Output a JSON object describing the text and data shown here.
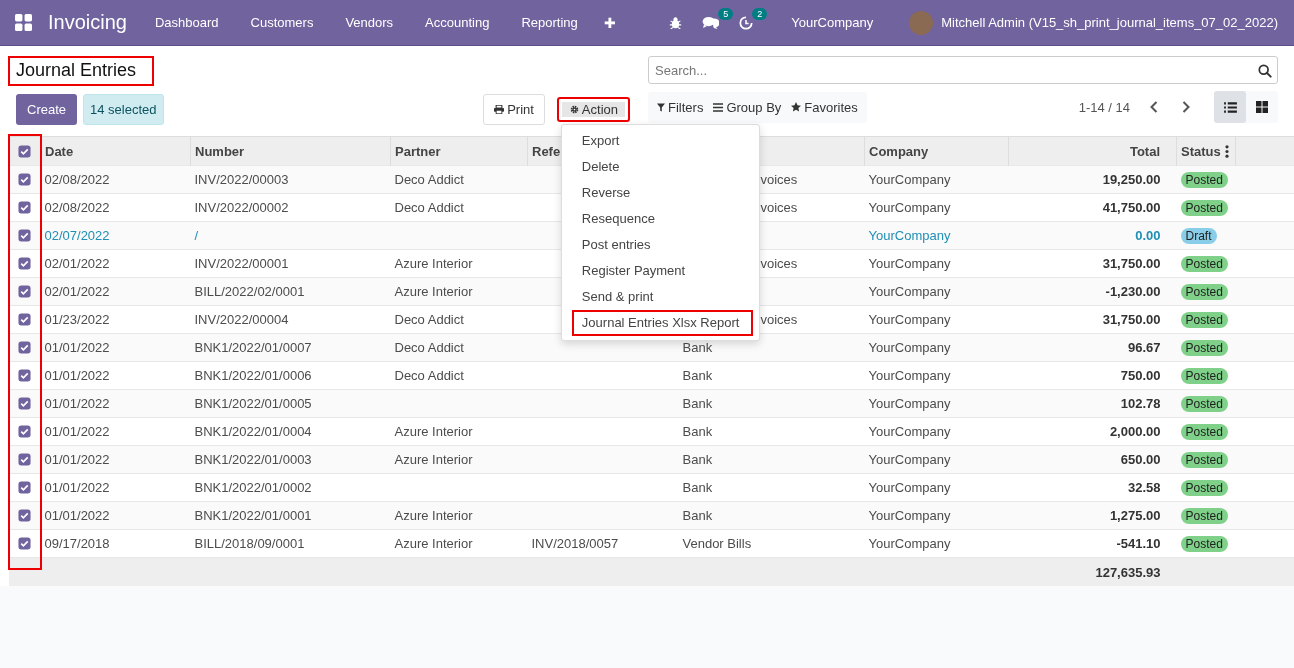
{
  "navbar": {
    "app_name": "Invoicing",
    "menu": [
      "Dashboard",
      "Customers",
      "Vendors",
      "Accounting",
      "Reporting"
    ],
    "add_symbol": "✚",
    "messages_badge": "5",
    "activities_badge": "2",
    "company": "YourCompany",
    "user": "Mitchell Admin (V15_sh_print_journal_items_07_02_2022)"
  },
  "control_panel": {
    "title": {
      "text": "Journal Entries",
      "highlighted": true
    },
    "create_button": "Create",
    "selected_count": "14 selected",
    "print_button": "Print",
    "action_button": {
      "label": "Action",
      "expanded": true,
      "highlighted": true
    },
    "search": {
      "placeholder": "Search..."
    },
    "filters": "Filters",
    "group_by": "Group By",
    "favorites": "Favorites",
    "pager": "1-14 / 14",
    "views": [
      {
        "kind": "list",
        "selected": true
      },
      {
        "kind": "kanban",
        "selected": false
      }
    ]
  },
  "action_menu": [
    {
      "label": "Export",
      "highlighted": false
    },
    {
      "label": "Delete",
      "highlighted": false
    },
    {
      "label": "Reverse",
      "highlighted": false
    },
    {
      "label": "Resequence",
      "highlighted": false
    },
    {
      "label": "Post entries",
      "highlighted": false
    },
    {
      "label": "Register Payment",
      "highlighted": false
    },
    {
      "label": "Send & print",
      "highlighted": false
    },
    {
      "label": "Journal Entries Xlsx Report",
      "highlighted": true
    }
  ],
  "table": {
    "select_all_checked": true,
    "select_column_highlighted": true,
    "columns": [
      "Date",
      "Number",
      "Partner",
      "Refe",
      "",
      "Company",
      "Total",
      "Status"
    ],
    "rows": [
      {
        "selected": true,
        "date": "02/08/2022",
        "number": "INV/2022/00003",
        "partner": "Deco Addict",
        "journal_partial": "voices",
        "company": "YourCompany",
        "total": "19,250.00",
        "status": {
          "text": "Posted",
          "kind": "posted"
        }
      },
      {
        "selected": true,
        "date": "02/08/2022",
        "number": "INV/2022/00002",
        "partner": "Deco Addict",
        "journal_partial": "voices",
        "company": "YourCompany",
        "total": "41,750.00",
        "status": {
          "text": "Posted",
          "kind": "posted"
        }
      },
      {
        "selected": true,
        "date": "02/07/2022",
        "number": "/",
        "company": "YourCompany",
        "total": "0.00",
        "status": {
          "text": "Draft",
          "kind": "draft"
        }
      },
      {
        "selected": true,
        "date": "02/01/2022",
        "number": "INV/2022/00001",
        "partner": "Azure Interior",
        "journal_partial": "voices",
        "company": "YourCompany",
        "total": "31,750.00",
        "status": {
          "text": "Posted",
          "kind": "posted"
        }
      },
      {
        "selected": true,
        "date": "02/01/2022",
        "number": "BILL/2022/02/0001",
        "partner": "Azure Interior",
        "company": "YourCompany",
        "total": "-1,230.00",
        "status": {
          "text": "Posted",
          "kind": "posted"
        }
      },
      {
        "selected": true,
        "date": "01/23/2022",
        "number": "INV/2022/00004",
        "partner": "Deco Addict",
        "journal_partial": "voices",
        "company": "YourCompany",
        "total": "31,750.00",
        "status": {
          "text": "Posted",
          "kind": "posted"
        }
      },
      {
        "selected": true,
        "date": "01/01/2022",
        "number": "BNK1/2022/01/0007",
        "partner": "Deco Addict",
        "journal": "Bank",
        "company": "YourCompany",
        "total": "96.67",
        "status": {
          "text": "Posted",
          "kind": "posted"
        }
      },
      {
        "selected": true,
        "date": "01/01/2022",
        "number": "BNK1/2022/01/0006",
        "partner": "Deco Addict",
        "journal": "Bank",
        "company": "YourCompany",
        "total": "750.00",
        "status": {
          "text": "Posted",
          "kind": "posted"
        }
      },
      {
        "selected": true,
        "date": "01/01/2022",
        "number": "BNK1/2022/01/0005",
        "journal": "Bank",
        "company": "YourCompany",
        "total": "102.78",
        "status": {
          "text": "Posted",
          "kind": "posted"
        }
      },
      {
        "selected": true,
        "date": "01/01/2022",
        "number": "BNK1/2022/01/0004",
        "partner": "Azure Interior",
        "journal": "Bank",
        "company": "YourCompany",
        "total": "2,000.00",
        "status": {
          "text": "Posted",
          "kind": "posted"
        }
      },
      {
        "selected": true,
        "date": "01/01/2022",
        "number": "BNK1/2022/01/0003",
        "partner": "Azure Interior",
        "journal": "Bank",
        "company": "YourCompany",
        "total": "650.00",
        "status": {
          "text": "Posted",
          "kind": "posted"
        }
      },
      {
        "selected": true,
        "date": "01/01/2022",
        "number": "BNK1/2022/01/0002",
        "journal": "Bank",
        "company": "YourCompany",
        "total": "32.58",
        "status": {
          "text": "Posted",
          "kind": "posted"
        }
      },
      {
        "selected": true,
        "date": "01/01/2022",
        "number": "BNK1/2022/01/0001",
        "partner": "Azure Interior",
        "journal": "Bank",
        "company": "YourCompany",
        "total": "1,275.00",
        "status": {
          "text": "Posted",
          "kind": "posted"
        }
      },
      {
        "selected": true,
        "date": "09/17/2018",
        "number": "BILL/2018/09/0001",
        "partner": "Azure Interior",
        "reference": "INV/2018/0057",
        "journal": "Vendor Bills",
        "company": "YourCompany",
        "total": "-541.10",
        "status": {
          "text": "Posted",
          "kind": "posted"
        }
      }
    ],
    "grand_total": "127,635.93"
  }
}
